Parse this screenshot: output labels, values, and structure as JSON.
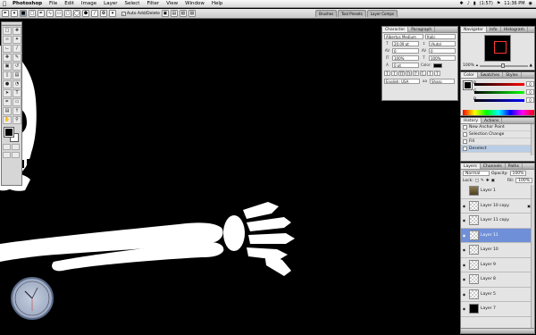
{
  "menubar": {
    "app_name": "Photoshop",
    "items": [
      "File",
      "Edit",
      "Image",
      "Layer",
      "Select",
      "Filter",
      "View",
      "Window",
      "Help"
    ],
    "battery": "(1:57)",
    "clock": "11:36 PM"
  },
  "options_bar": {
    "auto_add_delete_label": "Auto Add/Delete"
  },
  "palette_well": {
    "tabs": [
      "Brushes",
      "Tool Presets",
      "Layer Comps"
    ]
  },
  "character_panel": {
    "tabs": [
      "Character",
      "Paragraph"
    ],
    "font_family": "Albertus Medium",
    "font_style": "Italic",
    "font_size": "20.09 pt",
    "leading": "(Auto)",
    "kerning": "0",
    "tracking": "0",
    "vertical_scale": "100%",
    "horizontal_scale": "100%",
    "baseline_shift": "0 pt",
    "color_label": "Color:",
    "style_buttons": [
      "T",
      "T",
      "TT",
      "Tt",
      "T'",
      "T,",
      "T",
      "T"
    ],
    "language": "English: USA",
    "antialias": "Sharp"
  },
  "navigator_panel": {
    "tabs": [
      "Navigator",
      "Info",
      "Histogram"
    ],
    "zoom": "100%"
  },
  "color_panel": {
    "tabs": [
      "Color",
      "Swatches",
      "Styles"
    ],
    "channels": [
      {
        "label": "R",
        "value": "0"
      },
      {
        "label": "G",
        "value": "0"
      },
      {
        "label": "B",
        "value": "0"
      }
    ]
  },
  "history_panel": {
    "tabs": [
      "History",
      "Actions"
    ],
    "items": [
      {
        "label": "New Anchor Point",
        "selected": false
      },
      {
        "label": "Selection Change",
        "selected": false
      },
      {
        "label": "Fill",
        "selected": false
      },
      {
        "label": "Deselect",
        "selected": true
      }
    ]
  },
  "layers_panel": {
    "tabs": [
      "Layers",
      "Channels",
      "Paths"
    ],
    "blend_mode": "Normal",
    "opacity_label": "Opacity:",
    "opacity": "100%",
    "lock_label": "Lock:",
    "fill_label": "Fill:",
    "fill": "100%",
    "layers": [
      {
        "name": "Layer 1",
        "visible": false,
        "selected": false,
        "locked": false,
        "thumb": "art"
      },
      {
        "name": "Layer 10 copy",
        "visible": true,
        "selected": false,
        "locked": true,
        "thumb": "transparent"
      },
      {
        "name": "Layer 11 copy",
        "visible": true,
        "selected": false,
        "locked": false,
        "thumb": "transparent"
      },
      {
        "name": "Layer 11",
        "visible": true,
        "selected": true,
        "locked": false,
        "thumb": "transparent"
      },
      {
        "name": "Layer 10",
        "visible": true,
        "selected": false,
        "locked": false,
        "thumb": "transparent"
      },
      {
        "name": "Layer 9",
        "visible": true,
        "selected": false,
        "locked": false,
        "thumb": "transparent"
      },
      {
        "name": "Layer 8",
        "visible": true,
        "selected": false,
        "locked": false,
        "thumb": "transparent"
      },
      {
        "name": "Layer 5",
        "visible": true,
        "selected": false,
        "locked": false,
        "thumb": "transparent"
      },
      {
        "name": "Layer 7",
        "visible": true,
        "selected": false,
        "locked": false,
        "thumb": "dark"
      }
    ]
  }
}
